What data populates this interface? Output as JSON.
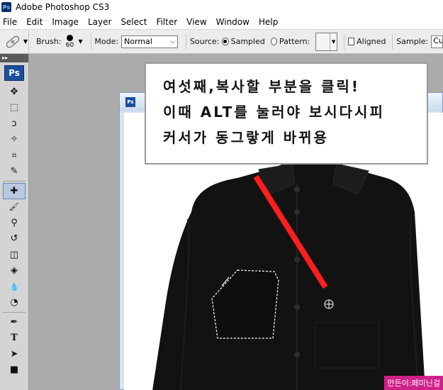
{
  "window": {
    "title": "Adobe Photoshop CS3",
    "logo_text": "Ps"
  },
  "menu": {
    "items": [
      "File",
      "Edit",
      "Image",
      "Layer",
      "Select",
      "Filter",
      "View",
      "Window",
      "Help"
    ]
  },
  "options": {
    "tool_icon": "healing-brush-icon",
    "brush_label": "Brush:",
    "brush_size": "60",
    "mode_label": "Mode:",
    "mode_value": "Normal",
    "source_label": "Source:",
    "source_sampled": "Sampled",
    "source_pattern": "Pattern:",
    "aligned_label": "Aligned",
    "sample_label": "Sample:",
    "sample_value": "Cu"
  },
  "toolbox": {
    "badge": "Ps",
    "tools": [
      {
        "name": "move-icon",
        "glyph": "✥"
      },
      {
        "name": "marquee-icon",
        "glyph": "⬚"
      },
      {
        "name": "lasso-icon",
        "glyph": "ↄ"
      },
      {
        "name": "magic-wand-icon",
        "glyph": "✧"
      },
      {
        "name": "crop-icon",
        "glyph": "⌗"
      },
      {
        "name": "slice-icon",
        "glyph": "✎"
      },
      {
        "name": "healing-brush-icon",
        "glyph": "✚"
      },
      {
        "name": "brush-icon",
        "glyph": "🖌"
      },
      {
        "name": "clone-stamp-icon",
        "glyph": "⚲"
      },
      {
        "name": "history-brush-icon",
        "glyph": "↺"
      },
      {
        "name": "eraser-icon",
        "glyph": "◫"
      },
      {
        "name": "paint-bucket-icon",
        "glyph": "◈"
      },
      {
        "name": "blur-icon",
        "glyph": "💧"
      },
      {
        "name": "dodge-icon",
        "glyph": "◔"
      },
      {
        "name": "pen-icon",
        "glyph": "✒"
      },
      {
        "name": "type-icon",
        "glyph": "T"
      },
      {
        "name": "path-selection-icon",
        "glyph": "➤"
      },
      {
        "name": "shape-icon",
        "glyph": "■"
      }
    ]
  },
  "document": {
    "icon_text": "Ps"
  },
  "callout": {
    "line1": "여섯째,복사할 부분을 클릭!",
    "line2": "이때 ALT를 눌러야 보시다시피",
    "line3": "커서가 동그랗게 바뀌용"
  },
  "watermark": "만든이:페미닌걸",
  "colors": {
    "annotation_line": "#ff1e1e",
    "shirt": "#121212",
    "watermark_bg": "#d0208a"
  }
}
